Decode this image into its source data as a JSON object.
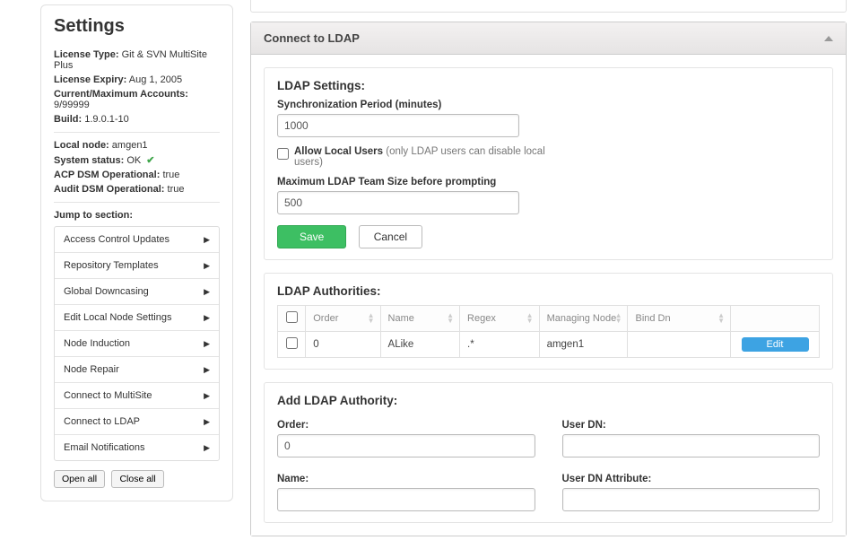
{
  "sidebar": {
    "title": "Settings",
    "info": {
      "licenseTypeLabel": "License Type:",
      "licenseType": "Git & SVN MultiSite Plus",
      "licenseExpiryLabel": "License Expiry:",
      "licenseExpiry": "Aug 1, 2005",
      "accountsLabel": "Current/Maximum Accounts:",
      "accounts": "9/99999",
      "buildLabel": "Build:",
      "build": "1.9.0.1-10",
      "localNodeLabel": "Local node:",
      "localNode": "amgen1",
      "systemStatusLabel": "System status:",
      "systemStatus": "OK",
      "acpLabel": "ACP DSM Operational:",
      "acp": "true",
      "auditLabel": "Audit DSM Operational:",
      "audit": "true"
    },
    "jumpLabel": "Jump to section:",
    "sections": [
      "Access Control Updates",
      "Repository Templates",
      "Global Downcasing",
      "Edit Local Node Settings",
      "Node Induction",
      "Node Repair",
      "Connect to MultiSite",
      "Connect to LDAP",
      "Email Notifications"
    ],
    "openAll": "Open all",
    "closeAll": "Close all"
  },
  "main": {
    "panelTitle": "Connect to LDAP",
    "ldapSettings": {
      "title": "LDAP Settings:",
      "syncLabel": "Synchronization Period (minutes)",
      "syncValue": "1000",
      "allowLocalBold": "Allow Local Users",
      "allowLocalRest": " (only LDAP users can disable local users)",
      "maxTeamLabel": "Maximum LDAP Team Size before prompting",
      "maxTeamValue": "500",
      "save": "Save",
      "cancel": "Cancel"
    },
    "authorities": {
      "title": "LDAP Authorities:",
      "headers": {
        "order": "Order",
        "name": "Name",
        "regex": "Regex",
        "managingNode": "Managing Node",
        "bindDn": "Bind Dn"
      },
      "row": {
        "order": "0",
        "name": "ALike",
        "regex": ".*",
        "managingNode": "amgen1",
        "bindDn": "",
        "edit": "Edit"
      }
    },
    "addAuthority": {
      "title": "Add LDAP Authority:",
      "orderLabel": "Order:",
      "orderValue": "0",
      "userDnLabel": "User DN:",
      "userDnValue": "",
      "nameLabel": "Name:",
      "nameValue": "",
      "userDnAttrLabel": "User DN Attribute:",
      "userDnAttrValue": ""
    }
  }
}
